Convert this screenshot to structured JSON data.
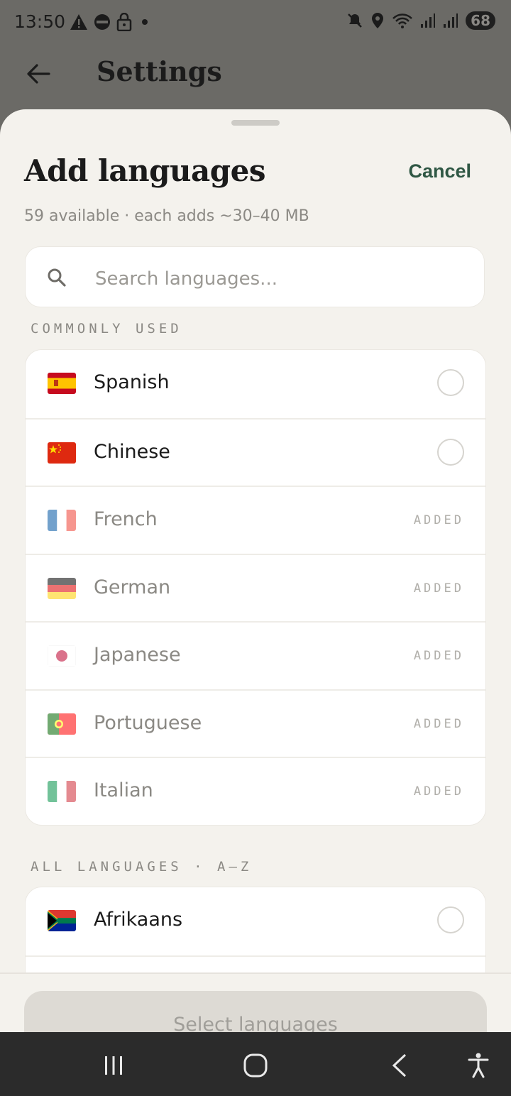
{
  "status_bar": {
    "time": "13:50",
    "battery": "68",
    "icons_left": [
      "warning-icon",
      "circle-half-icon",
      "lock-icon",
      "dot-icon"
    ],
    "icons_right": [
      "mute-icon",
      "location-icon",
      "wifi-icon",
      "signal-icon",
      "signal-icon"
    ]
  },
  "app_bar": {
    "title": "Settings"
  },
  "sheet": {
    "title": "Add languages",
    "cancel_label": "Cancel",
    "subtitle": "59 available · each adds ~30–40 MB",
    "search": {
      "placeholder": "Search languages..."
    },
    "common_section_label": "COMMONLY USED",
    "common_languages": [
      {
        "name": "Spanish",
        "status": "unselected",
        "flag": "es"
      },
      {
        "name": "Chinese",
        "status": "unselected",
        "flag": "cn"
      },
      {
        "name": "French",
        "status": "added",
        "added_label": "ADDED",
        "flag": "fr"
      },
      {
        "name": "German",
        "status": "added",
        "added_label": "ADDED",
        "flag": "de"
      },
      {
        "name": "Japanese",
        "status": "added",
        "added_label": "ADDED",
        "flag": "jp"
      },
      {
        "name": "Portuguese",
        "status": "added",
        "added_label": "ADDED",
        "flag": "pt"
      },
      {
        "name": "Italian",
        "status": "added",
        "added_label": "ADDED",
        "flag": "it"
      }
    ],
    "all_section_label": "ALL LANGUAGES · A–Z",
    "all_languages": [
      {
        "name": "Afrikaans",
        "status": "unselected",
        "flag": "za"
      }
    ],
    "select_button_label": "Select languages"
  },
  "colors": {
    "accent": "#2f5744",
    "sheet_background": "#f4f2ed",
    "scrim": "#6b6a66"
  }
}
